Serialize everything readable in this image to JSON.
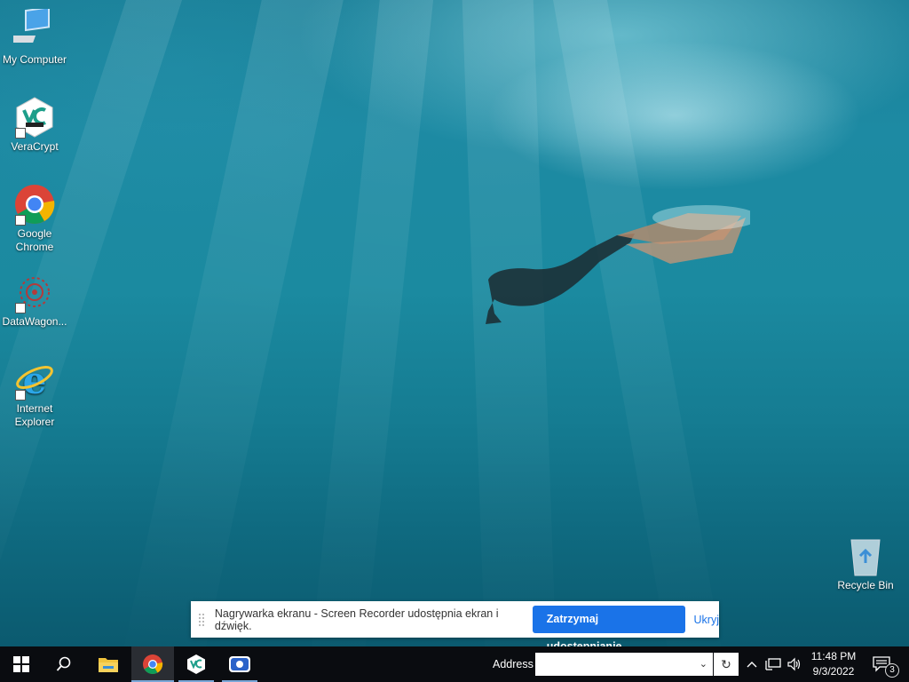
{
  "desktop": {
    "icons": [
      {
        "label": "My Computer",
        "icon": "computer-icon"
      },
      {
        "label": "VeraCrypt",
        "icon": "veracrypt-icon"
      },
      {
        "label": "Google Chrome",
        "icon": "chrome-icon"
      },
      {
        "label": "DataWagon...",
        "icon": "datawagon-icon"
      },
      {
        "label": "Internet Explorer",
        "icon": "internet-explorer-icon"
      }
    ],
    "recycle_bin": {
      "label": "Recycle Bin",
      "icon": "recycle-bin-icon"
    }
  },
  "share_bar": {
    "message": "Nagrywarka ekranu - Screen Recorder udostępnia ekran i dźwięk.",
    "stop_label": "Zatrzymaj udostępnianie",
    "hide_label": "Ukryj"
  },
  "taskbar": {
    "start_icon": "windows-start-icon",
    "search_icon": "search-icon",
    "pinned": [
      {
        "name": "file-explorer",
        "icon": "folder-icon"
      },
      {
        "name": "google-chrome",
        "icon": "chrome-icon",
        "active": true
      },
      {
        "name": "veracrypt",
        "icon": "veracrypt-icon"
      },
      {
        "name": "screen-recorder",
        "icon": "screen-recorder-icon"
      }
    ],
    "address_label": "Address",
    "address_value": "",
    "clock_time": "11:48 PM",
    "clock_date": "9/3/2022",
    "notification_count": "3"
  },
  "colors": {
    "accent": "#1a73e8",
    "taskbar": "#0a0c10"
  }
}
